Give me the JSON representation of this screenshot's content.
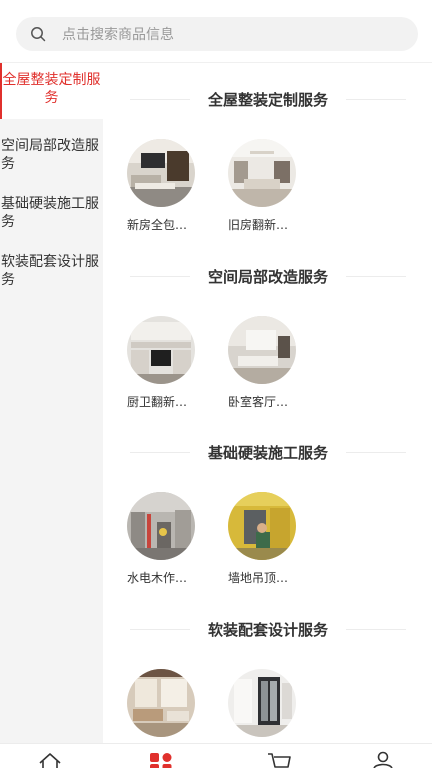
{
  "search": {
    "placeholder": "点击搜索商品信息"
  },
  "sidebar": {
    "items": [
      {
        "label": "全屋整装定制服务",
        "active": true
      },
      {
        "label": "空间局部改造服务",
        "active": false
      },
      {
        "label": "基础硬装施工服务",
        "active": false
      },
      {
        "label": "软装配套设计服务",
        "active": false
      }
    ]
  },
  "sections": [
    {
      "title": "全屋整装定制服务",
      "products": [
        {
          "label": "新房全包…"
        },
        {
          "label": "旧房翻新…"
        }
      ]
    },
    {
      "title": "空间局部改造服务",
      "products": [
        {
          "label": "厨卫翻新…"
        },
        {
          "label": "卧室客厅…"
        }
      ]
    },
    {
      "title": "基础硬装施工服务",
      "products": [
        {
          "label": "水电木作…"
        },
        {
          "label": "墙地吊顶…"
        }
      ]
    },
    {
      "title": "软装配套设计服务",
      "products": [
        {
          "label": ""
        },
        {
          "label": ""
        }
      ]
    }
  ],
  "colors": {
    "accent": "#e0302c",
    "sidebar_bg": "#f4f4f4",
    "search_bg": "#f2f2f2"
  },
  "tabbar": {
    "icons": [
      "home-icon",
      "category-icon",
      "cart-icon",
      "profile-icon"
    ]
  }
}
